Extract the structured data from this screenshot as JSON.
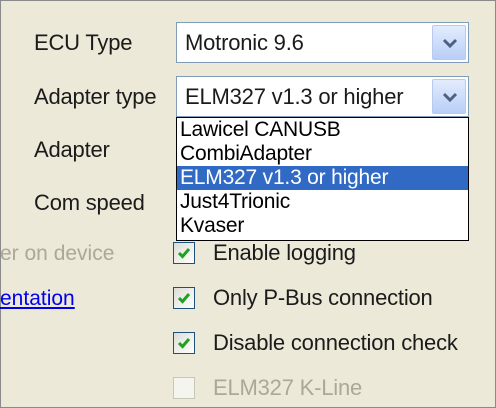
{
  "labels": {
    "ecu_type": "ECU Type",
    "adapter_type": "Adapter type",
    "adapter": "Adapter",
    "com_speed": "Com speed"
  },
  "ecu_combo": {
    "value": "Motronic 9.6"
  },
  "adapter_combo": {
    "value": "ELM327 v1.3 or higher",
    "options": [
      "Lawicel CANUSB",
      "CombiAdapter",
      "ELM327 v1.3 or higher",
      "Just4Trionic",
      "Kvaser"
    ],
    "selected_index": 2
  },
  "left_partial": {
    "log_on_device": "er on device",
    "documentation_link": "entation"
  },
  "checkboxes": {
    "enable_logging": {
      "label": "Enable logging",
      "checked": true
    },
    "only_pbus": {
      "label": "Only P-Bus connection",
      "checked": true
    },
    "disable_check": {
      "label": "Disable connection check",
      "checked": true
    },
    "elm_kline": {
      "label": "ELM327 K-Line",
      "checked": false,
      "enabled": false
    }
  },
  "colors": {
    "window_bg": "#ece9d8",
    "selection": "#316ac5",
    "checkmark": "#21a121",
    "link": "#0000ee",
    "disabled_text": "#aca899"
  }
}
